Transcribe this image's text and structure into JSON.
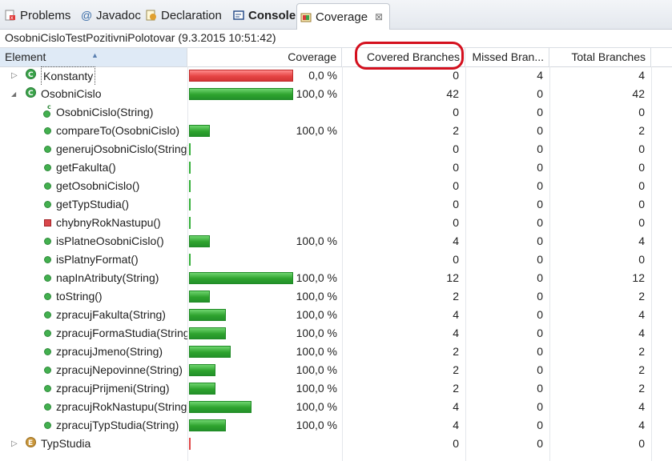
{
  "tabs": [
    {
      "label": "Problems",
      "icon": "problems-icon"
    },
    {
      "label": "Javadoc",
      "icon": "javadoc-icon"
    },
    {
      "label": "Declaration",
      "icon": "declaration-icon"
    },
    {
      "label": "Console",
      "icon": "console-icon"
    },
    {
      "label": "Coverage",
      "icon": "coverage-icon",
      "close": "⊠"
    }
  ],
  "session": "OsobniCisloTestPozitivniPolotovar (9.3.2015 10:51:42)",
  "columns": {
    "element": "Element",
    "coverage": "Coverage",
    "covered": "Covered Branches",
    "missed": "Missed Bran...",
    "total": "Total Branches"
  },
  "rows": [
    {
      "name": "Konstanty",
      "kind": "class",
      "level": 0,
      "twisty": "collapsed",
      "coverage": "0,0 %",
      "covered": "0",
      "missed": "4",
      "total": "4",
      "bar": "red",
      "bar_fraction": 1.0
    },
    {
      "name": "OsobniCislo",
      "kind": "class",
      "level": 0,
      "twisty": "expanded",
      "coverage": "100,0 %",
      "covered": "42",
      "missed": "0",
      "total": "42",
      "bar": "green",
      "bar_fraction": 1.0
    },
    {
      "name": "OsobniCislo(String)",
      "kind": "ctor",
      "level": 1,
      "coverage": "",
      "covered": "0",
      "missed": "0",
      "total": "0",
      "bar": "none",
      "bar_fraction": 0
    },
    {
      "name": "compareTo(OsobniCislo)",
      "kind": "method",
      "level": 1,
      "coverage": "100,0 %",
      "covered": "2",
      "missed": "0",
      "total": "2",
      "bar": "green",
      "bar_fraction": 0.2
    },
    {
      "name": "generujOsobniCislo(String)",
      "kind": "method",
      "level": 1,
      "coverage": "",
      "covered": "0",
      "missed": "0",
      "total": "0",
      "bar": "sliver",
      "bar_fraction": 0
    },
    {
      "name": "getFakulta()",
      "kind": "method",
      "level": 1,
      "coverage": "",
      "covered": "0",
      "missed": "0",
      "total": "0",
      "bar": "sliver",
      "bar_fraction": 0
    },
    {
      "name": "getOsobniCislo()",
      "kind": "method",
      "level": 1,
      "coverage": "",
      "covered": "0",
      "missed": "0",
      "total": "0",
      "bar": "sliver",
      "bar_fraction": 0
    },
    {
      "name": "getTypStudia()",
      "kind": "method",
      "level": 1,
      "coverage": "",
      "covered": "0",
      "missed": "0",
      "total": "0",
      "bar": "sliver",
      "bar_fraction": 0
    },
    {
      "name": "chybnyRokNastupu()",
      "kind": "private",
      "level": 1,
      "coverage": "",
      "covered": "0",
      "missed": "0",
      "total": "0",
      "bar": "sliver",
      "bar_fraction": 0
    },
    {
      "name": "isPlatneOsobniCislo()",
      "kind": "method",
      "level": 1,
      "coverage": "100,0 %",
      "covered": "4",
      "missed": "0",
      "total": "4",
      "bar": "green",
      "bar_fraction": 0.2
    },
    {
      "name": "isPlatnyFormat()",
      "kind": "method",
      "level": 1,
      "coverage": "",
      "covered": "0",
      "missed": "0",
      "total": "0",
      "bar": "sliver",
      "bar_fraction": 0
    },
    {
      "name": "napInAtributy(String)",
      "kind": "method",
      "level": 1,
      "coverage": "100,0 %",
      "covered": "12",
      "missed": "0",
      "total": "12",
      "bar": "green",
      "bar_fraction": 1.0
    },
    {
      "name": "toString()",
      "kind": "method",
      "level": 1,
      "coverage": "100,0 %",
      "covered": "2",
      "missed": "0",
      "total": "2",
      "bar": "green",
      "bar_fraction": 0.2
    },
    {
      "name": "zpracujFakulta(String)",
      "kind": "method",
      "level": 1,
      "coverage": "100,0 %",
      "covered": "4",
      "missed": "0",
      "total": "4",
      "bar": "green",
      "bar_fraction": 0.35
    },
    {
      "name": "zpracujFormaStudia(String)",
      "kind": "method",
      "level": 1,
      "coverage": "100,0 %",
      "covered": "4",
      "missed": "0",
      "total": "4",
      "bar": "green",
      "bar_fraction": 0.35
    },
    {
      "name": "zpracujJmeno(String)",
      "kind": "method",
      "level": 1,
      "coverage": "100,0 %",
      "covered": "2",
      "missed": "0",
      "total": "2",
      "bar": "green",
      "bar_fraction": 0.4
    },
    {
      "name": "zpracujNepovinne(String)",
      "kind": "method",
      "level": 1,
      "coverage": "100,0 %",
      "covered": "2",
      "missed": "0",
      "total": "2",
      "bar": "green",
      "bar_fraction": 0.25
    },
    {
      "name": "zpracujPrijmeni(String)",
      "kind": "method",
      "level": 1,
      "coverage": "100,0 %",
      "covered": "2",
      "missed": "0",
      "total": "2",
      "bar": "green",
      "bar_fraction": 0.25
    },
    {
      "name": "zpracujRokNastupu(String)",
      "kind": "method",
      "level": 1,
      "coverage": "100,0 %",
      "covered": "4",
      "missed": "0",
      "total": "4",
      "bar": "green",
      "bar_fraction": 0.6
    },
    {
      "name": "zpracujTypStudia(String)",
      "kind": "method",
      "level": 1,
      "coverage": "100,0 %",
      "covered": "4",
      "missed": "0",
      "total": "4",
      "bar": "green",
      "bar_fraction": 0.35
    },
    {
      "name": "TypStudia",
      "kind": "enum",
      "level": 0,
      "twisty": "collapsed",
      "coverage": "",
      "covered": "0",
      "missed": "0",
      "total": "0",
      "bar": "sliver-red",
      "bar_fraction": 0
    }
  ],
  "colors": {
    "bar_green": "#2ea32e",
    "bar_red": "#e64545",
    "callout": "#d4101e",
    "sorted_header": "#dfeaf6"
  }
}
